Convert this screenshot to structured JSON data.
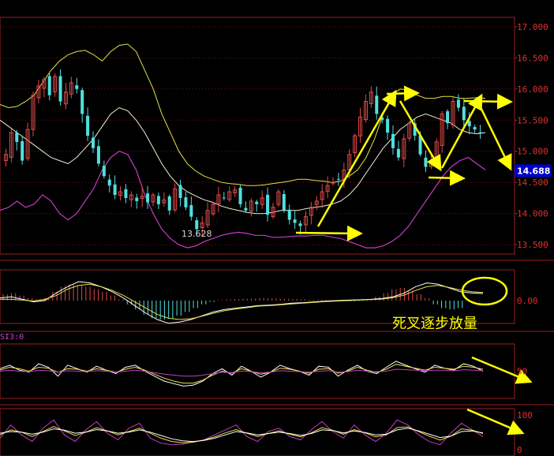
{
  "colors": {
    "background": "#000000",
    "frame": "#9a1f1f",
    "grid": "#7a1515",
    "axis_text": "#e03030",
    "up": "#e04a4a",
    "down": "#4fe0e0",
    "upper_band": "#e6e04a",
    "mid_band": "#f0f0d0",
    "lower_band": "#c33cc3",
    "annotation": "#ffff00",
    "price_tag_bg": "#0000cc"
  },
  "chart_data": [
    {
      "type": "candlestick",
      "panel": "price",
      "title": "",
      "ylim": [
        13.35,
        17.15
      ],
      "y_ticks": [
        "17.000",
        "16.500",
        "16.000",
        "15.500",
        "15.000",
        "14.500",
        "14.000",
        "13.500"
      ],
      "current_price_label": "14.688",
      "current_price": 14.688,
      "low_label": "13.628",
      "low_value": 13.628,
      "candle_count": 88,
      "series": [
        {
          "name": "",
          "role": "candles",
          "close_path": [
            14.95,
            15.3,
            15.15,
            14.85,
            15.35,
            15.9,
            16.05,
            16.15,
            15.9,
            16.2,
            15.8,
            15.95,
            16.1,
            16.0,
            15.6,
            15.25,
            15.05,
            14.8,
            14.6,
            14.45,
            14.3,
            14.35,
            14.25,
            14.3,
            14.2,
            14.28,
            14.18,
            14.3,
            14.15,
            14.22,
            14.05,
            14.4,
            14.25,
            14.1,
            13.95,
            13.75,
            13.85,
            14.05,
            14.15,
            14.3,
            14.25,
            14.35,
            14.38,
            14.15,
            14.05,
            14.2,
            14.15,
            14.25,
            13.98,
            14.1,
            14.35,
            14.05,
            13.9,
            13.85,
            13.8,
            13.95,
            14.1,
            14.2,
            14.35,
            14.45,
            14.5,
            14.55,
            14.7,
            14.95,
            15.25,
            15.55,
            15.8,
            15.95,
            15.6,
            15.5,
            15.3,
            15.05,
            14.9,
            15.2,
            15.45,
            15.25,
            14.95,
            14.75,
            14.85,
            15.15,
            15.6,
            15.45,
            15.8,
            15.7,
            15.5,
            15.4,
            15.35,
            15.3
          ]
        },
        {
          "name": "",
          "role": "upper-band",
          "values": [
            15.75,
            15.7,
            15.72,
            15.8,
            15.9,
            16.1,
            16.3,
            16.45,
            16.55,
            16.6,
            16.62,
            16.55,
            16.45,
            16.6,
            16.7,
            16.72,
            16.6,
            16.3,
            16.0,
            15.6,
            15.3,
            15.0,
            14.8,
            14.68,
            14.6,
            14.55,
            14.5,
            14.48,
            14.47,
            14.45,
            14.45,
            14.46,
            14.48,
            14.5,
            14.52,
            14.55,
            14.55,
            14.53,
            14.52,
            14.5,
            14.52,
            14.6,
            14.7,
            14.9,
            15.2,
            15.6,
            15.9,
            16.0,
            15.98,
            15.9,
            15.85,
            15.85,
            15.88,
            15.88,
            15.85,
            15.85,
            15.86,
            15.85
          ]
        },
        {
          "name": "",
          "role": "middle-band",
          "values": [
            15.5,
            15.4,
            15.3,
            15.2,
            15.1,
            15.0,
            14.9,
            14.85,
            14.8,
            14.9,
            15.05,
            15.2,
            15.4,
            15.6,
            15.7,
            15.65,
            15.5,
            15.3,
            15.05,
            14.8,
            14.6,
            14.45,
            14.35,
            14.28,
            14.22,
            14.18,
            14.12,
            14.08,
            14.05,
            14.02,
            14.0,
            14.0,
            14.02,
            14.05,
            14.05,
            14.05,
            14.08,
            14.1,
            14.12,
            14.15,
            14.2,
            14.3,
            14.45,
            14.65,
            14.85,
            15.05,
            15.2,
            15.35,
            15.45,
            15.55,
            15.6,
            15.55,
            15.5,
            15.45,
            15.35,
            15.3,
            15.28,
            15.3
          ]
        },
        {
          "name": "",
          "role": "lower-band",
          "values": [
            14.05,
            14.1,
            14.2,
            14.1,
            14.15,
            14.3,
            14.2,
            14.0,
            13.9,
            14.0,
            14.2,
            14.4,
            14.7,
            14.9,
            15.0,
            14.95,
            14.7,
            14.3,
            14.0,
            13.75,
            13.6,
            13.5,
            13.45,
            13.48,
            13.55,
            13.6,
            13.65,
            13.68,
            13.7,
            13.68,
            13.65,
            13.65,
            13.62,
            13.62,
            13.63,
            13.64,
            13.64,
            13.65,
            13.65,
            13.62,
            13.6,
            13.55,
            13.5,
            13.45,
            13.45,
            13.48,
            13.55,
            13.65,
            13.8,
            14.0,
            14.2,
            14.4,
            14.6,
            14.75,
            14.85,
            14.9,
            14.8,
            14.7
          ]
        }
      ]
    },
    {
      "type": "bar",
      "panel": "macd",
      "y_ticks": [
        "0.00"
      ],
      "ylim": [
        -1,
        1
      ],
      "annotation": "死叉逐步放量",
      "series": [
        {
          "name": "",
          "role": "histogram",
          "values": [
            0.25,
            0.3,
            0.2,
            0.1,
            0.05,
            0.1,
            0.35,
            0.55,
            0.65,
            0.6,
            0.55,
            0.45,
            0.35,
            0.2,
            0.05,
            -0.15,
            -0.35,
            -0.55,
            -0.7,
            -0.75,
            -0.7,
            -0.6,
            -0.45,
            -0.3,
            -0.15,
            -0.05,
            0.02,
            0.05,
            0.06,
            0.07,
            0.08,
            0.1,
            0.09,
            0.08,
            0.07,
            0.06,
            0.05,
            0.04,
            0.03,
            0.02,
            0.01,
            -0.02,
            -0.03,
            -0.02,
            0.05,
            0.15,
            0.3,
            0.45,
            0.5,
            0.4,
            0.25,
            0.1,
            -0.15,
            -0.3,
            -0.35,
            -0.3,
            0.0,
            0.02
          ]
        },
        {
          "name": "",
          "role": "dif",
          "values": [
            0.1,
            0.15,
            0.05,
            -0.05,
            0.0,
            0.3,
            0.55,
            0.75,
            0.7,
            0.55,
            0.35,
            0.1,
            -0.2,
            -0.5,
            -0.75,
            -0.9,
            -0.85,
            -0.75,
            -0.6,
            -0.45,
            -0.35,
            -0.3,
            -0.25,
            -0.2,
            -0.18,
            -0.15,
            -0.1,
            -0.08,
            -0.05,
            -0.02,
            0.0,
            0.02,
            0.03,
            0.05,
            0.08,
            0.15,
            0.3,
            0.55,
            0.7,
            0.65,
            0.5,
            0.35,
            0.3,
            0.28
          ]
        },
        {
          "name": "",
          "role": "dea",
          "values": [
            0.05,
            0.05,
            0.02,
            -0.02,
            0.05,
            0.2,
            0.45,
            0.6,
            0.65,
            0.55,
            0.4,
            0.2,
            -0.05,
            -0.3,
            -0.55,
            -0.7,
            -0.75,
            -0.72,
            -0.62,
            -0.5,
            -0.4,
            -0.33,
            -0.28,
            -0.22,
            -0.2,
            -0.17,
            -0.13,
            -0.1,
            -0.07,
            -0.04,
            -0.02,
            0.0,
            0.02,
            0.04,
            0.06,
            0.12,
            0.22,
            0.4,
            0.55,
            0.6,
            0.52,
            0.42,
            0.35,
            0.32
          ]
        }
      ]
    },
    {
      "type": "line",
      "panel": "indicator-1",
      "indicator_label": "SI3:0",
      "y_ticks": [
        "50"
      ],
      "ylim": [
        0,
        100
      ],
      "series": [
        {
          "name": "",
          "role": "white-line",
          "values": [
            55,
            62,
            52,
            48,
            65,
            58,
            40,
            62,
            55,
            48,
            60,
            52,
            45,
            58,
            62,
            50,
            40,
            30,
            25,
            20,
            22,
            30,
            45,
            55,
            42,
            60,
            50,
            38,
            48,
            62,
            55,
            50,
            42,
            60,
            58,
            40,
            52,
            62,
            50,
            45,
            58,
            70,
            62,
            55,
            48,
            62,
            56,
            52,
            65,
            60,
            50
          ]
        },
        {
          "name": "",
          "role": "yellow-line",
          "values": [
            52,
            58,
            55,
            50,
            58,
            56,
            48,
            55,
            54,
            50,
            55,
            52,
            48,
            54,
            58,
            52,
            44,
            36,
            30,
            26,
            26,
            32,
            42,
            50,
            46,
            55,
            50,
            44,
            48,
            56,
            54,
            50,
            46,
            54,
            55,
            46,
            50,
            58,
            52,
            48,
            54,
            64,
            60,
            56,
            52,
            58,
            56,
            54,
            60,
            58,
            54
          ]
        },
        {
          "name": "",
          "role": "magenta-line",
          "values": [
            50,
            52,
            50,
            49,
            52,
            51,
            48,
            51,
            50,
            49,
            51,
            50,
            48,
            50,
            52,
            50,
            47,
            44,
            42,
            40,
            40,
            42,
            45,
            48,
            47,
            50,
            49,
            47,
            48,
            51,
            50,
            49,
            48,
            50,
            51,
            48,
            49,
            52,
            50,
            49,
            50,
            54,
            53,
            52,
            51,
            52,
            52,
            51,
            53,
            52,
            51
          ]
        }
      ]
    },
    {
      "type": "line",
      "panel": "indicator-2",
      "y_ticks": [
        "100",
        "0"
      ],
      "ylim": [
        0,
        100
      ],
      "series": [
        {
          "name": "",
          "role": "magenta-line",
          "values": [
            30,
            70,
            40,
            20,
            60,
            85,
            40,
            20,
            55,
            80,
            45,
            25,
            60,
            75,
            30,
            15,
            10,
            12,
            18,
            25,
            40,
            55,
            70,
            35,
            20,
            50,
            60,
            35,
            25,
            55,
            80,
            50,
            30,
            70,
            40,
            20,
            45,
            85,
            70,
            40,
            20,
            10,
            45,
            75,
            55,
            35
          ]
        },
        {
          "name": "",
          "role": "yellow-line",
          "values": [
            40,
            55,
            48,
            35,
            50,
            65,
            52,
            38,
            48,
            62,
            52,
            40,
            50,
            60,
            45,
            30,
            20,
            16,
            18,
            24,
            34,
            46,
            56,
            45,
            35,
            44,
            52,
            42,
            34,
            46,
            62,
            54,
            42,
            56,
            46,
            34,
            40,
            62,
            64,
            50,
            36,
            24,
            36,
            58,
            54,
            44
          ]
        },
        {
          "name": "",
          "role": "white-line",
          "values": [
            45,
            50,
            48,
            42,
            48,
            58,
            54,
            45,
            48,
            56,
            52,
            45,
            48,
            55,
            48,
            38,
            28,
            22,
            20,
            23,
            30,
            40,
            50,
            46,
            40,
            44,
            48,
            44,
            38,
            44,
            55,
            53,
            46,
            52,
            47,
            40,
            42,
            55,
            60,
            52,
            42,
            32,
            36,
            50,
            52,
            46
          ]
        }
      ]
    }
  ]
}
